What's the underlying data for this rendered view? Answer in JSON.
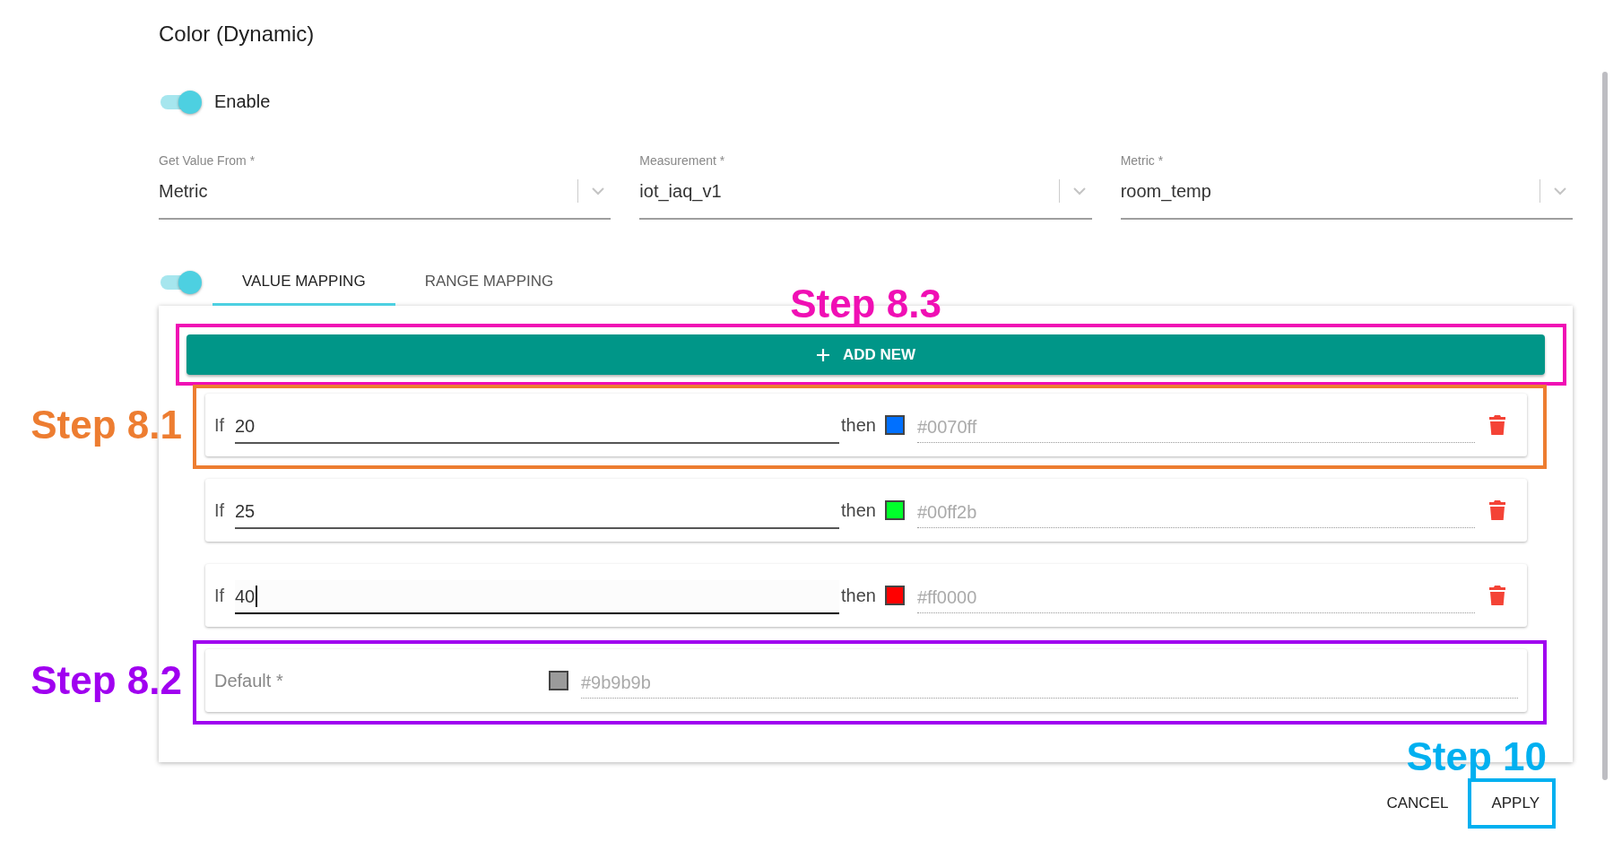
{
  "title": "Color (Dynamic)",
  "enable": {
    "label": "Enable",
    "on": true
  },
  "fields": [
    {
      "label": "Get Value From *",
      "value": "Metric"
    },
    {
      "label": "Measurement *",
      "value": "iot_iaq_v1"
    },
    {
      "label": "Metric *",
      "value": "room_temp"
    }
  ],
  "mapping_toggle": {
    "on": true
  },
  "tabs": [
    {
      "label": "VALUE MAPPING",
      "selected": true
    },
    {
      "label": "RANGE MAPPING",
      "selected": false
    }
  ],
  "add_button": {
    "label": "ADD NEW",
    "callout": {
      "text": "Step 8.3",
      "color": "#f00fb4"
    }
  },
  "mappings": [
    {
      "if_label": "If",
      "value": "20",
      "focused": false,
      "then_label": "then",
      "color": "#0070ff",
      "color_text": "#0070ff",
      "callout": {
        "text": "Step 8.1",
        "color": "#ed7d31"
      }
    },
    {
      "if_label": "If",
      "value": "25",
      "focused": false,
      "then_label": "then",
      "color": "#00ff2b",
      "color_text": "#00ff2b"
    },
    {
      "if_label": "If",
      "value": "40",
      "focused": true,
      "then_label": "then",
      "color": "#ff0000",
      "color_text": "#ff0000"
    }
  ],
  "default": {
    "label": "Default *",
    "color": "#9b9b9b",
    "color_text": "#9b9b9b",
    "callout": {
      "text": "Step 8.2",
      "color": "#a000f0"
    }
  },
  "buttons": [
    {
      "label": "CANCEL"
    },
    {
      "label": "APPLY",
      "callout": {
        "text": "Step 10",
        "color": "#00b0f0"
      }
    }
  ]
}
